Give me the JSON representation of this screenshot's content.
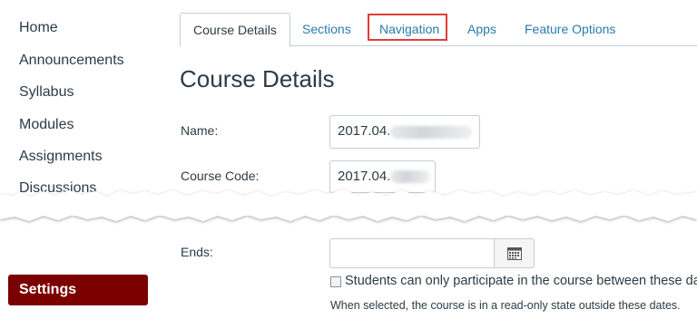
{
  "sidebar": {
    "items": [
      {
        "label": "Home"
      },
      {
        "label": "Announcements"
      },
      {
        "label": "Syllabus"
      },
      {
        "label": "Modules"
      },
      {
        "label": "Assignments"
      },
      {
        "label": "Discussions"
      }
    ],
    "active_label": "Settings"
  },
  "tabs": [
    {
      "label": "Course Details"
    },
    {
      "label": "Sections"
    },
    {
      "label": "Navigation"
    },
    {
      "label": "Apps"
    },
    {
      "label": "Feature Options"
    }
  ],
  "page_title": "Course Details",
  "form": {
    "name_label": "Name:",
    "name_value": "2017.04.",
    "code_label": "Course Code:",
    "code_value": "2017.04.",
    "ends_label": "Ends:",
    "participate_label": "Students can only participate in the course between these dates",
    "participate_hint": "When selected, the course is in a read-only state outside these dates."
  },
  "colors": {
    "accent_link": "#2a7ab0",
    "active_nav": "#7b0000",
    "highlight_box": "#e03d3d"
  }
}
